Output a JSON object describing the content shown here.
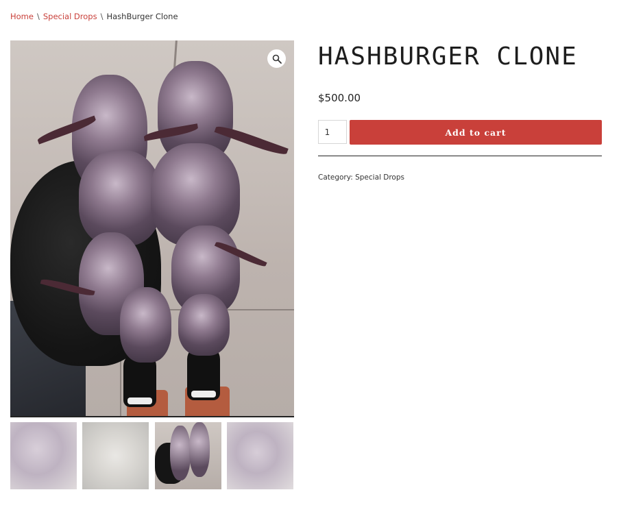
{
  "breadcrumb": {
    "home": "Home",
    "separator": "\\",
    "category": "Special Drops",
    "current": "HashBurger Clone"
  },
  "product": {
    "title": "HASHBURGER CLONE",
    "price": "$500.00",
    "quantity": "1",
    "add_to_cart_label": "Add to cart",
    "category_label": "Category:",
    "category_value": "Special Drops"
  },
  "gallery": {
    "zoom_icon": "magnifier-icon",
    "thumbnails": [
      {
        "name": "thumbnail-1",
        "active": false
      },
      {
        "name": "thumbnail-2",
        "active": false
      },
      {
        "name": "thumbnail-3",
        "active": true
      },
      {
        "name": "thumbnail-4",
        "active": false
      }
    ]
  },
  "colors": {
    "accent": "#c9403a",
    "title": "#1d1d1d"
  }
}
